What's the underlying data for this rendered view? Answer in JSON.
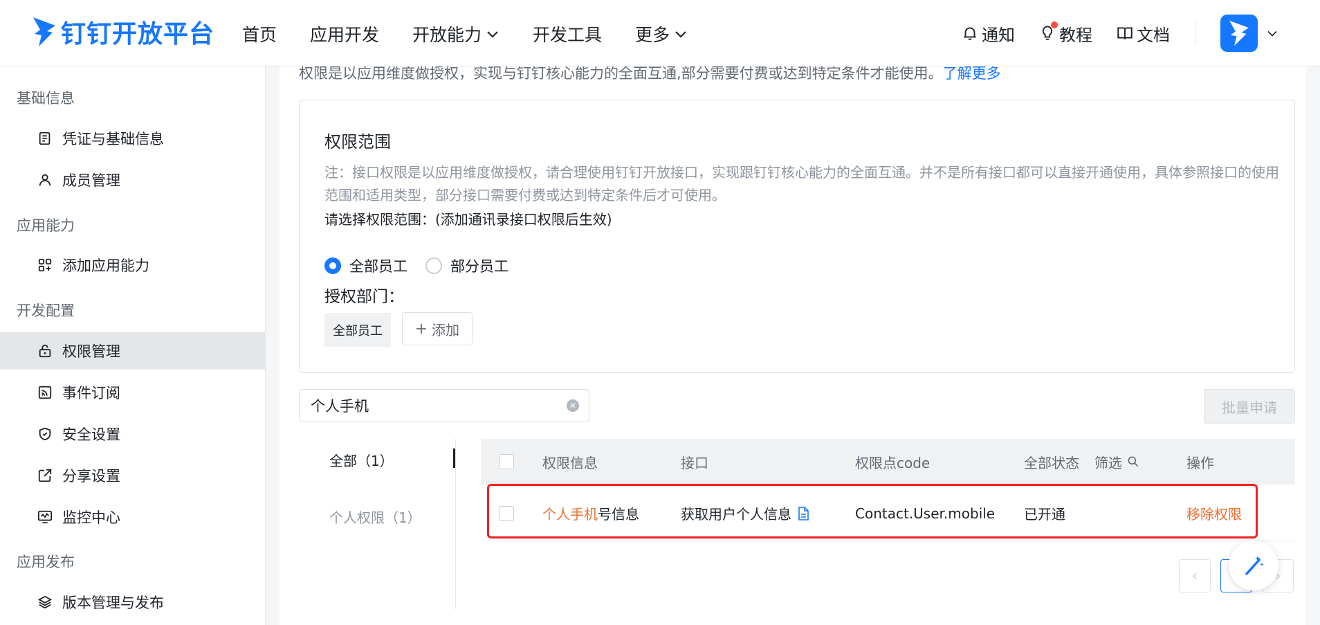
{
  "header": {
    "logo_text": "钉钉开放平台",
    "nav": [
      {
        "label": "首页",
        "has_dropdown": false
      },
      {
        "label": "应用开发",
        "has_dropdown": false
      },
      {
        "label": "开放能力",
        "has_dropdown": true
      },
      {
        "label": "开发工具",
        "has_dropdown": false
      },
      {
        "label": "更多",
        "has_dropdown": true
      }
    ],
    "notify_label": "通知",
    "tutorial_label": "教程",
    "docs_label": "文档"
  },
  "sidebar": {
    "groups": [
      {
        "title": "基础信息",
        "items": [
          {
            "label": "凭证与基础信息",
            "icon": "document-icon"
          },
          {
            "label": "成员管理",
            "icon": "user-icon"
          }
        ]
      },
      {
        "title": "应用能力",
        "items": [
          {
            "label": "添加应用能力",
            "icon": "grid-plus-icon"
          }
        ]
      },
      {
        "title": "开发配置",
        "items": [
          {
            "label": "权限管理",
            "icon": "lock-icon",
            "active": true
          },
          {
            "label": "事件订阅",
            "icon": "rss-icon"
          },
          {
            "label": "安全设置",
            "icon": "shield-icon"
          },
          {
            "label": "分享设置",
            "icon": "share-icon"
          },
          {
            "label": "监控中心",
            "icon": "monitor-icon"
          }
        ]
      },
      {
        "title": "应用发布",
        "items": [
          {
            "label": "版本管理与发布",
            "icon": "layers-icon"
          }
        ]
      }
    ]
  },
  "main": {
    "description": "权限是以应用维度做授权，实现与钉钉核心能力的全面互通,部分需要付费或达到特定条件才能使用。",
    "learn_more": "了解更多",
    "scope": {
      "title": "权限范围",
      "note": "注：接口权限是以应用维度做授权，请合理使用钉钉开放接口，实现跟钉钉核心能力的全面互通。并不是所有接口都可以直接开通使用，具体参照接口的使用范围和适用类型，部分接口需要付费或达到特定条件后才可使用。",
      "select_label": "请选择权限范围：(添加通讯录接口权限后生效)",
      "radio_all": "全部员工",
      "radio_partial": "部分员工",
      "selected": "全部员工",
      "dept_label": "授权部门：",
      "dept_tag": "全部员工",
      "add_label": "添加"
    },
    "search": {
      "value": "个人手机"
    },
    "batch_apply": "批量申请",
    "categories": {
      "all": "全部（1）",
      "personal": "个人权限（1）"
    },
    "table": {
      "headers": {
        "info": "权限信息",
        "api": "接口",
        "code": "权限点code",
        "status": "全部状态",
        "filter": "筛选",
        "action": "操作"
      },
      "rows": [
        {
          "info_highlight": "个人手机",
          "info_rest": "号信息",
          "api": "获取用户个人信息",
          "code": "Contact.User.mobile",
          "status": "已开通",
          "action": "移除权限"
        }
      ]
    }
  },
  "colors": {
    "brand": "#1677ff",
    "highlight": "#f06e2d",
    "outline": "#ee2121"
  }
}
